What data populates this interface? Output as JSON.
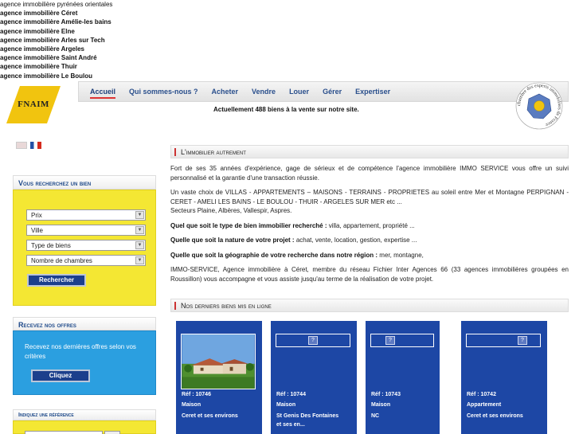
{
  "top_links": [
    "agence immobilière pyrénées orientales",
    "agence immobilière Céret",
    "agence immobilière Amélie-les bains",
    "agence immobilière Elne",
    "agence immobilière Arles sur Tech",
    "agence immobilière Argeles",
    "agence immobilière Saint André",
    "agence immobilière Thuir",
    "agence immobilière Le Boulou"
  ],
  "logo": {
    "text": "FNAIM"
  },
  "nav": {
    "items": [
      "Accueil",
      "Qui sommes-nous ?",
      "Acheter",
      "Vendre",
      "Louer",
      "Gérer",
      "Expertiser"
    ],
    "active": "Accueil"
  },
  "counter": "Actuellement 488 biens à la vente sur notre site.",
  "seal": {
    "text": "chambre des experts immobiliers de France"
  },
  "search": {
    "title": "Vous recherchez un bien",
    "selects": [
      "Prix",
      "Ville",
      "Type de biens",
      "Nombre de chambres"
    ],
    "button": "Rechercher"
  },
  "offers": {
    "title": "Recevez nos offres",
    "text": "Recevez nos dernières offres selon vos critères",
    "button": "Cliquez"
  },
  "reference": {
    "title": "Indiquez une référence"
  },
  "intro": {
    "title": "L'immobilier autrement",
    "p1": "Fort de ses 35 années d'expérience, gage de sérieux et de compétence l'agence immobilière IMMO SERVICE vous offre un suivi personnalisé et la garantie d'une transaction réussie.",
    "p2": "Un vaste choix de VILLAS - APPARTEMENTS – MAISONS - TERRAINS - PROPRIETES au soleil entre Mer et Montagne PERPIGNAN - CERET - AMELI LES BAINS - LE BOULOU - THUIR - ARGELES SUR MER etc ...",
    "p2b": "Secteurs Plaine, Albères, Vallespir, Aspres.",
    "q1_label": "Quel que soit le type de bien immobilier recherché :",
    "q1_text": " villa, appartement, propriété ...",
    "q2_label": "Quelle que soit la nature de votre projet :",
    "q2_text": " achat, vente, location, gestion, expertise ...",
    "q3_label": "Quelle que soit la géographie de votre recherche dans notre région :",
    "q3_text": " mer, montagne,",
    "p3": "IMMO-SERVICE, Agence immobilière à Céret, membre du réseau Fichier Inter Agences 66 (33 agences immobilières groupées en Roussillon) vous accompagne et vous assiste jusqu'au terme de la réalisation de votre projet."
  },
  "latest": {
    "title": "Nos derniers biens mis en ligne",
    "cards": [
      {
        "ref": "Réf : 10746",
        "type": "Maison",
        "place": "Ceret et ses environs",
        "place2": ""
      },
      {
        "ref": "Réf : 10744",
        "type": "Maison",
        "place": "St Genis Des Fontaines",
        "place2": "et ses en..."
      },
      {
        "ref": "Réf : 10743",
        "type": "Maison",
        "place": "NC",
        "place2": ""
      },
      {
        "ref": "Réf : 10742",
        "type": "Appartement",
        "place": "Ceret et ses environs",
        "place2": ""
      }
    ]
  },
  "colors": {
    "nav_text": "#2a4f8c",
    "yellow_box": "#f4e733",
    "blue_box": "#2b9fe0",
    "card_blue": "#1d47a5",
    "button_blue": "#1c3f8c"
  }
}
